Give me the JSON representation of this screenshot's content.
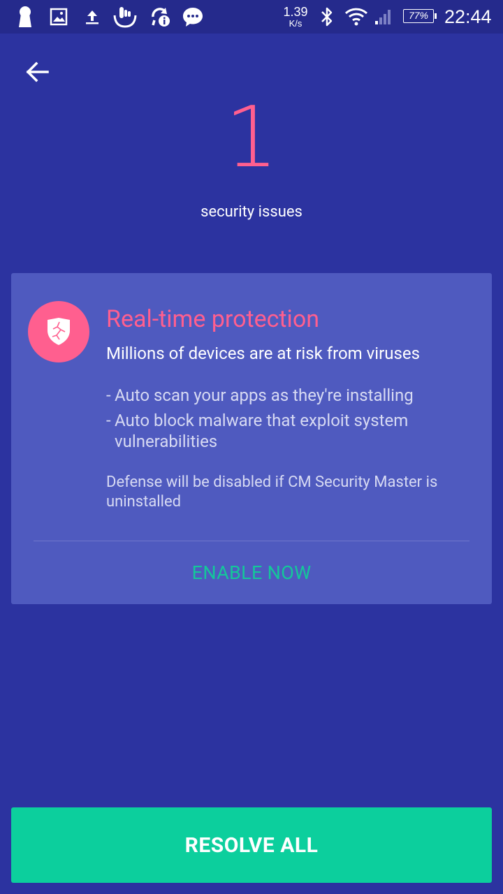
{
  "status_bar": {
    "net_speed_value": "1.39",
    "net_speed_unit": "K/s",
    "battery": "77%",
    "time": "22:44",
    "icons": [
      "keyhole-icon",
      "gallery-icon",
      "upload-icon",
      "touchpal-icon",
      "sync-info-icon",
      "chat-icon",
      "bluetooth-icon",
      "wifi-icon",
      "signal-icon",
      "battery-icon"
    ]
  },
  "header": {
    "back_icon": "arrow-left-icon"
  },
  "summary": {
    "count": "1",
    "label": "security issues"
  },
  "card": {
    "icon": "broken-shield-icon",
    "title": "Real-time protection",
    "subtitle": "Millions of devices are at risk from viruses",
    "features": [
      "Auto scan your apps as they're installing",
      "Auto block malware that exploit system vulnerabilities"
    ],
    "note": "Defense will be disabled if CM Security Master is uninstalled",
    "action_label": "ENABLE NOW"
  },
  "footer": {
    "resolve_label": "RESOLVE ALL"
  },
  "colors": {
    "background": "#2c33a0",
    "status_bar": "#252a8c",
    "card": "#4f5abf",
    "accent_pink": "#ff5f8f",
    "accent_green": "#0ccf9d",
    "enable_text": "#14c79a"
  }
}
